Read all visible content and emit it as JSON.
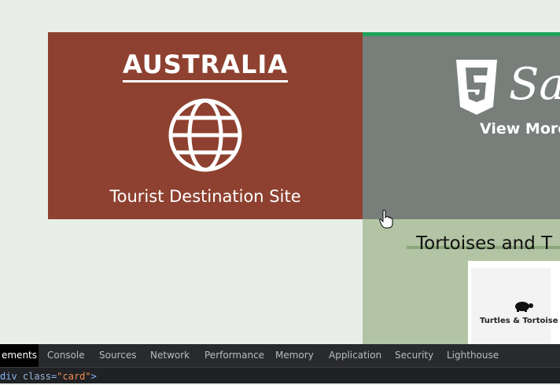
{
  "cards": {
    "australia": {
      "title": "AUSTRALIA",
      "subtitle": "Tourist Destination Site",
      "icon": "globe-icon",
      "background": "#8e4130"
    },
    "html_card": {
      "logo_letter": "5",
      "script_text": "Sa",
      "button_label": "View More",
      "icon": "html5-logo-icon",
      "background": "#787f7b",
      "accent": "#1ea35a"
    },
    "tortoise": {
      "title": "Tortoises and T",
      "image_caption": "Turtles & Tortoise",
      "icon": "turtle-icon",
      "background": "#b2c4a4"
    }
  },
  "devtools": {
    "tabs": [
      "ements",
      "Console",
      "Sources",
      "Network",
      "Performance",
      "Memory",
      "Application",
      "Security",
      "Lighthouse"
    ],
    "active_tab": "ements",
    "code_line": {
      "tag_open": "div ",
      "attr_name": "class",
      "eq": "=",
      "attr_value": "\"card\"",
      "tag_close": ">"
    }
  }
}
